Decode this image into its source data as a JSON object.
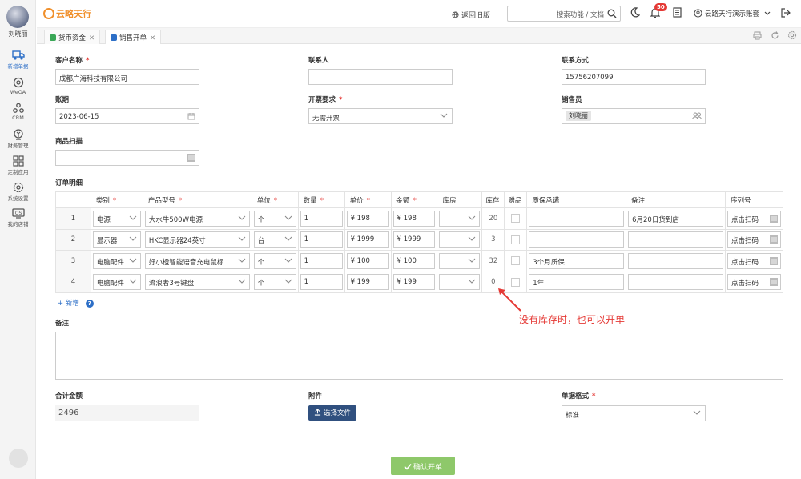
{
  "user": {
    "name": "刘晓丽"
  },
  "sidebar": {
    "items": [
      {
        "label": "新增单据",
        "icon": "truck-icon",
        "active": true
      },
      {
        "label": "WeOA",
        "icon": "gear-icon"
      },
      {
        "label": "CRM",
        "icon": "crm-icon"
      },
      {
        "label": "财务管理",
        "icon": "finance-icon"
      },
      {
        "label": "定制应用",
        "icon": "grid-icon"
      },
      {
        "label": "系统设置",
        "icon": "settings-icon"
      },
      {
        "label": "我的店铺",
        "icon": "store-icon"
      }
    ]
  },
  "header": {
    "logo_text": "云略天行",
    "back_old": "返回旧版",
    "search_placeholder": "搜索功能 / 文档",
    "notification_count": "50",
    "account": "云路天行演示账套"
  },
  "tabs": [
    {
      "label": "货币资金"
    },
    {
      "label": "销售开单",
      "active": true
    }
  ],
  "form": {
    "customer": {
      "label": "客户名称",
      "value": "成都广海科技有限公司"
    },
    "contact": {
      "label": "联系人",
      "value": ""
    },
    "phone": {
      "label": "联系方式",
      "value": "15756207099"
    },
    "period": {
      "label": "账期",
      "value": "2023-06-15"
    },
    "invoice": {
      "label": "开票要求",
      "value": "无需开票"
    },
    "salesperson": {
      "label": "销售员",
      "value": "刘晓丽"
    },
    "scan": {
      "label": "商品扫描",
      "value": ""
    },
    "detail_label": "订单明细",
    "columns": [
      "类别",
      "产品型号",
      "单位",
      "数量",
      "单价",
      "金额",
      "库房",
      "库存",
      "赠品",
      "质保承诺",
      "备注",
      "序列号"
    ],
    "rows": [
      {
        "idx": "1",
        "category": "电源",
        "model": "大水牛500W电源",
        "unit": "个",
        "qty": "1",
        "price": "¥ 198",
        "amount": "¥ 198",
        "stock": "20",
        "warranty": "",
        "note": "6月20日货到店",
        "serial": "点击扫码"
      },
      {
        "idx": "2",
        "category": "显示器",
        "model": "HKC显示器24英寸",
        "unit": "台",
        "qty": "1",
        "price": "¥ 1999",
        "amount": "¥ 1999",
        "stock": "3",
        "warranty": "",
        "note": "",
        "serial": "点击扫码"
      },
      {
        "idx": "3",
        "category": "电脑配件",
        "model": "好小橙智能语音充电鼠标",
        "unit": "个",
        "qty": "1",
        "price": "¥ 100",
        "amount": "¥ 100",
        "stock": "32",
        "warranty": "3个月质保",
        "note": "",
        "serial": "点击扫码"
      },
      {
        "idx": "4",
        "category": "电脑配件",
        "model": "流浪者3号键盘",
        "unit": "个",
        "qty": "1",
        "price": "¥ 199",
        "amount": "¥ 199",
        "stock": "0",
        "warranty": "1年",
        "note": "",
        "serial": "点击扫码"
      }
    ],
    "add_row": "+ 新增",
    "remark_label": "备注",
    "annotation": "没有库存时，也可以开单",
    "total": {
      "label": "合计金额",
      "value": "2496"
    },
    "attachment": {
      "label": "附件",
      "button": "选择文件"
    },
    "doc_format": {
      "label": "单据格式",
      "value": "标准"
    },
    "confirm": "确认开单"
  },
  "colors": {
    "primary": "#30507f",
    "confirm": "#8ec86a",
    "required": "#e53935",
    "annotation": "#e53935"
  }
}
